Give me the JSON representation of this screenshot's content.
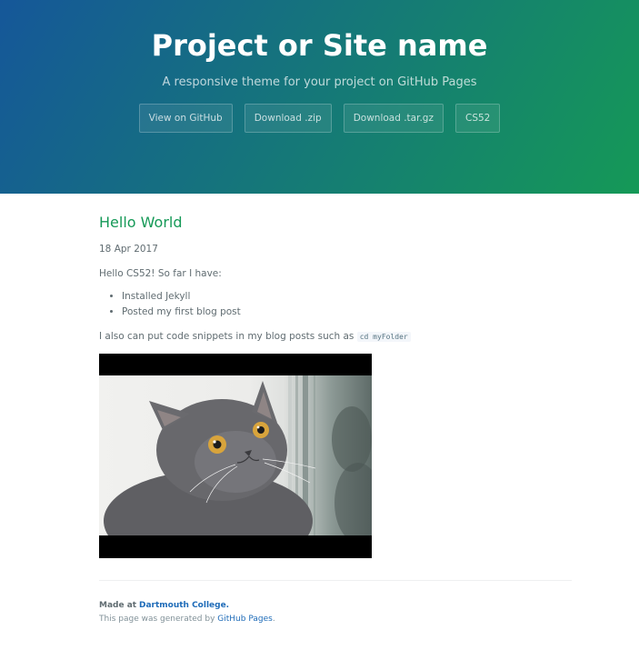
{
  "header": {
    "title": "Project or Site name",
    "tagline": "A responsive theme for your project on GitHub Pages",
    "buttons": [
      "View on GitHub",
      "Download .zip",
      "Download .tar.gz",
      "CS52"
    ]
  },
  "post": {
    "title": "Hello World",
    "date": "18 Apr 2017",
    "intro": "Hello CS52! So far I have:",
    "items": [
      "Installed Jekyll",
      "Posted my first blog post"
    ],
    "code_sentence": "I also can put code snippets in my blog posts such as",
    "code_snippet": "cd myFolder",
    "image": "surprised-gray-cat-photo"
  },
  "footer": {
    "made_at": "Made at",
    "college": "Dartmouth College.",
    "generated_prefix": "This page was generated by",
    "github_pages": "GitHub Pages",
    "generated_suffix": "."
  },
  "colors": {
    "header_gradient_start": "#155799",
    "header_gradient_end": "#159957",
    "title_green": "#159957",
    "link_blue": "#1e6bb8"
  }
}
